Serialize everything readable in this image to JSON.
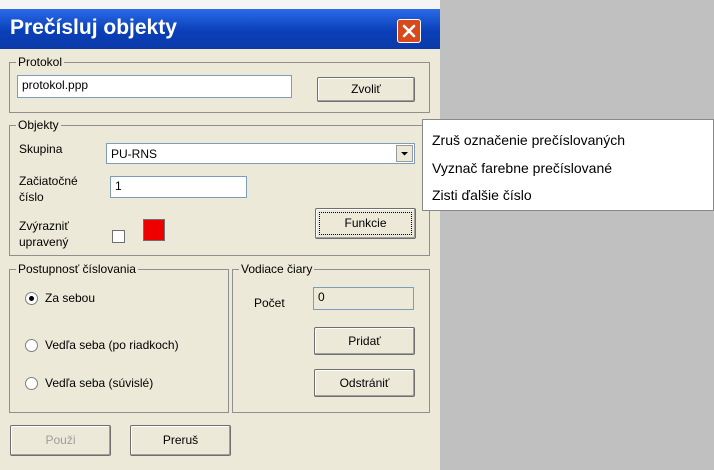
{
  "window": {
    "title": "Prečísluj objekty",
    "close_icon": "close-icon"
  },
  "protokol": {
    "label": "Protokol",
    "file_value": "protokol.ppp",
    "choose_label": "Zvoliť"
  },
  "objekty": {
    "label": "Objekty",
    "group_label": "Skupina",
    "group_value": "PU-RNS",
    "start_label_1": "Začiatočné",
    "start_label_2": "číslo",
    "start_value": "1",
    "highlight_label_1": "Zvýrazniť",
    "highlight_label_2": "upravený",
    "highlight_color": "#ee0000",
    "functions_label": "Funkcie"
  },
  "order": {
    "label": "Postupnosť číslovania",
    "options": [
      "Za sebou",
      "Vedľa seba  (po riadkoch)",
      "Vedľa seba  (súvislé)"
    ],
    "selected_index": 0
  },
  "lines": {
    "label": "Vodiace čiary",
    "count_label": "Počet",
    "count_value": "0",
    "add_label": "Pridať",
    "remove_label": "Odstrániť"
  },
  "footer": {
    "apply_label": "Použi",
    "cancel_label": "Preruš"
  },
  "context_menu": {
    "items": [
      "Zruš označenie prečíslovaných",
      "Vyznač farebne prečíslované",
      "Zisti ďalšie číslo"
    ]
  }
}
